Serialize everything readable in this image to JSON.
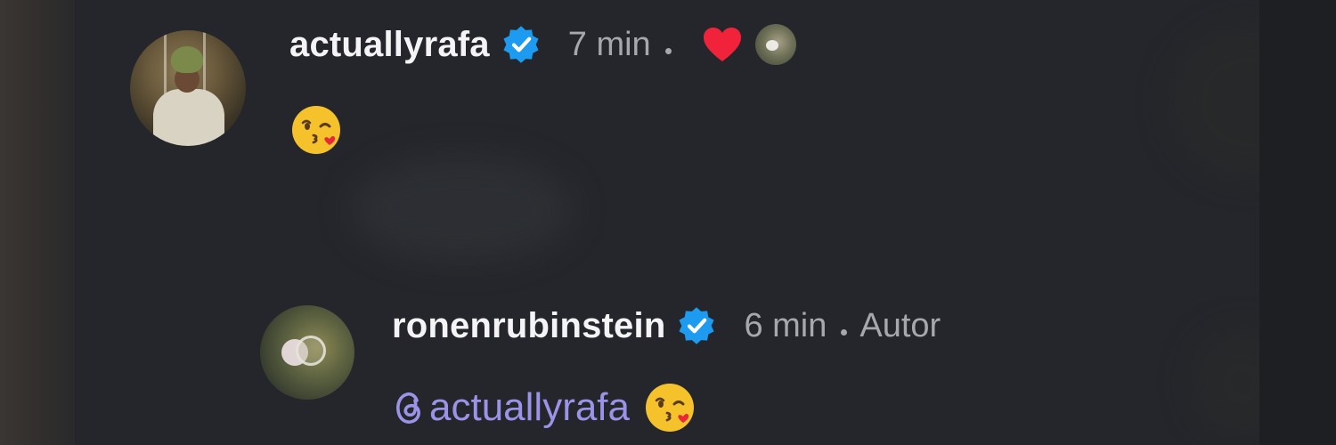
{
  "comments": [
    {
      "username": "actuallyrafa",
      "verified": true,
      "time": "7 min",
      "liked_by_author": true,
      "emoji_text": "kissing-heart-emoji",
      "avatar": "profile-photo"
    },
    {
      "username": "ronenrubinstein",
      "verified": true,
      "time": "6 min",
      "author_label": "Autor",
      "mention": "actuallyrafa",
      "emoji_text": "kissing-heart-emoji",
      "avatar": "profile-photo"
    }
  ],
  "colors": {
    "background": "#24262b",
    "username": "#f4f4f6",
    "meta": "#a6a8ae",
    "verified": "#1d9bf0",
    "heart": "#f0233a",
    "mention": "#9b93e8"
  }
}
